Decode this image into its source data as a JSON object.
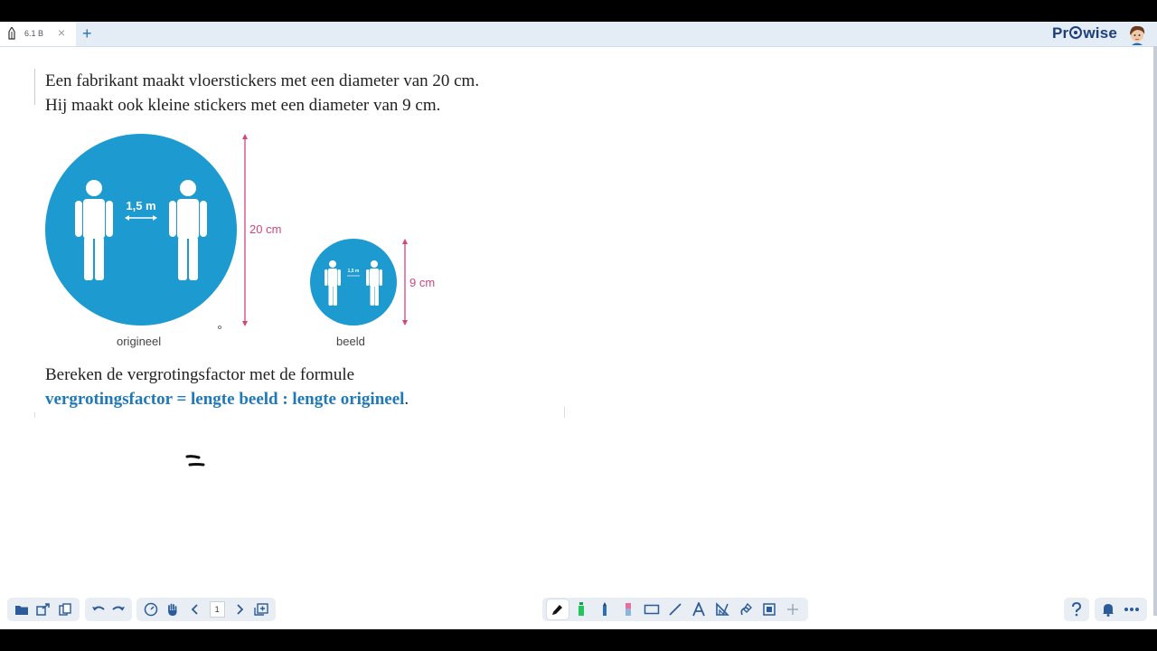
{
  "tab": {
    "title": "6.1 B",
    "close": "×",
    "add": "+"
  },
  "brand": {
    "pre": "Pr",
    "post": "wise"
  },
  "content": {
    "line1": "Een fabrikant maakt vloerstickers met een diameter van 20 cm.",
    "line2": "Hij maakt ook kleine stickers met een diameter van 9 cm.",
    "big_sticker_label": "1,5 m",
    "small_sticker_label": "1,5 m",
    "big_dimension": "20 cm",
    "small_dimension": "9 cm",
    "caption_original": "origineel",
    "caption_image": "beeld",
    "line3": "Bereken de vergrotingsfactor met de formule",
    "formula": "vergrotingsfactor = lengte beeld : lengte origineel",
    "formula_end": "."
  },
  "toolbar": {
    "page_number": "1"
  },
  "colors": {
    "sticker_blue": "#1d9bd0",
    "dimension_pink": "#d1467a",
    "formula_blue": "#1f79b8"
  }
}
